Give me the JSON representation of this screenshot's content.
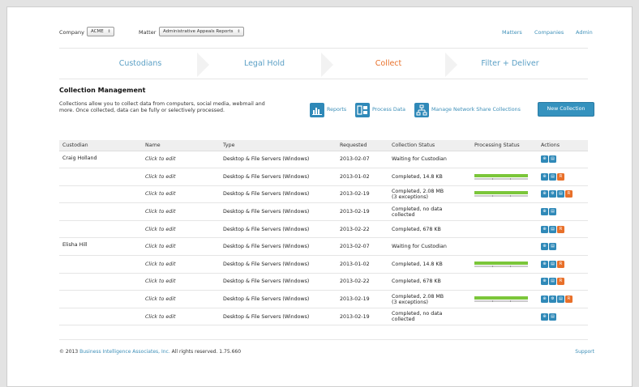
{
  "topbar": {
    "company_label": "Company",
    "company_value": "ACME",
    "matter_label": "Matter",
    "matter_value": "Administrative Appeals Reports",
    "links": [
      "Matters",
      "Companies",
      "Admin"
    ]
  },
  "steps": [
    {
      "label": "Custodians",
      "active": false
    },
    {
      "label": "Legal Hold",
      "active": false
    },
    {
      "label": "Collect",
      "active": true
    },
    {
      "label": "Filter + Deliver",
      "active": false
    }
  ],
  "section": {
    "title": "Collection Management",
    "description": "Collections allow you to collect data from computers, social media, webmail and more. Once collected, data can be fully or selectively processed."
  },
  "toolbar": {
    "reports_label": "Reports",
    "process_label": "Process Data",
    "network_label": "Manage Network Share Collections",
    "new_label": "New Collection"
  },
  "table": {
    "headers": [
      "Custodian",
      "Name",
      "Type",
      "Requested",
      "Collection Status",
      "Processing Status",
      "Actions"
    ],
    "rows": [
      {
        "custodian": "Craig Holland",
        "name": "Click to edit",
        "type": "Desktop & File Servers (Windows)",
        "requested": "2013-02-07",
        "status": "Waiting for Custodian",
        "status2": "",
        "progress": null,
        "actions": [
          "view",
          "doc"
        ]
      },
      {
        "custodian": "",
        "name": "Click to edit",
        "type": "Desktop & File Servers (Windows)",
        "requested": "2013-01-02",
        "status": "Completed, 14.8 KB",
        "status2": "",
        "progress": 1.0,
        "actions": [
          "view",
          "doc",
          "rev"
        ]
      },
      {
        "custodian": "",
        "name": "Click to edit",
        "type": "Desktop & File Servers (Windows)",
        "requested": "2013-02-19",
        "status": "Completed, 2.08 MB",
        "status2": "(3 exceptions)",
        "progress": 1.0,
        "actions": [
          "view",
          "proc",
          "doc",
          "rev"
        ]
      },
      {
        "custodian": "",
        "name": "Click to edit",
        "type": "Desktop & File Servers (Windows)",
        "requested": "2013-02-19",
        "status": "Completed, no data",
        "status2": "collected",
        "progress": null,
        "actions": [
          "view",
          "doc"
        ]
      },
      {
        "custodian": "",
        "name": "Click to edit",
        "type": "Desktop & File Servers (Windows)",
        "requested": "2013-02-22",
        "status": "Completed, 678 KB",
        "status2": "",
        "progress": null,
        "actions": [
          "view",
          "doc",
          "rev"
        ]
      },
      {
        "custodian": "Elisha Hill",
        "name": "Click to edit",
        "type": "Desktop & File Servers (Windows)",
        "requested": "2013-02-07",
        "status": "Waiting for Custodian",
        "status2": "",
        "progress": null,
        "actions": [
          "view",
          "doc"
        ]
      },
      {
        "custodian": "",
        "name": "Click to edit",
        "type": "Desktop & File Servers (Windows)",
        "requested": "2013-01-02",
        "status": "Completed, 14.8 KB",
        "status2": "",
        "progress": 1.0,
        "actions": [
          "view",
          "doc",
          "rev"
        ]
      },
      {
        "custodian": "",
        "name": "Click to edit",
        "type": "Desktop & File Servers (Windows)",
        "requested": "2013-02-22",
        "status": "Completed, 678 KB",
        "status2": "",
        "progress": null,
        "actions": [
          "view",
          "doc",
          "rev"
        ]
      },
      {
        "custodian": "",
        "name": "Click to edit",
        "type": "Desktop & File Servers (Windows)",
        "requested": "2013-02-19",
        "status": "Completed, 2.08 MB",
        "status2": "(3 exceptions)",
        "progress": 1.0,
        "actions": [
          "view",
          "proc",
          "doc",
          "rev"
        ]
      },
      {
        "custodian": "",
        "name": "Click to edit",
        "type": "Desktop & File Servers (Windows)",
        "requested": "2013-02-19",
        "status": "Completed, no data",
        "status2": "collected",
        "progress": null,
        "actions": [
          "view",
          "doc"
        ]
      }
    ]
  },
  "footer": {
    "prefix": "© 2013",
    "company": "Business Intelligence Associates, Inc.",
    "suffix": "All rights reserved. 1.75.660",
    "support": "Support"
  },
  "colors": {
    "accent": "#3592be",
    "active_step": "#e8702a",
    "progress": "#7bc63a",
    "review": "#e8702a"
  }
}
